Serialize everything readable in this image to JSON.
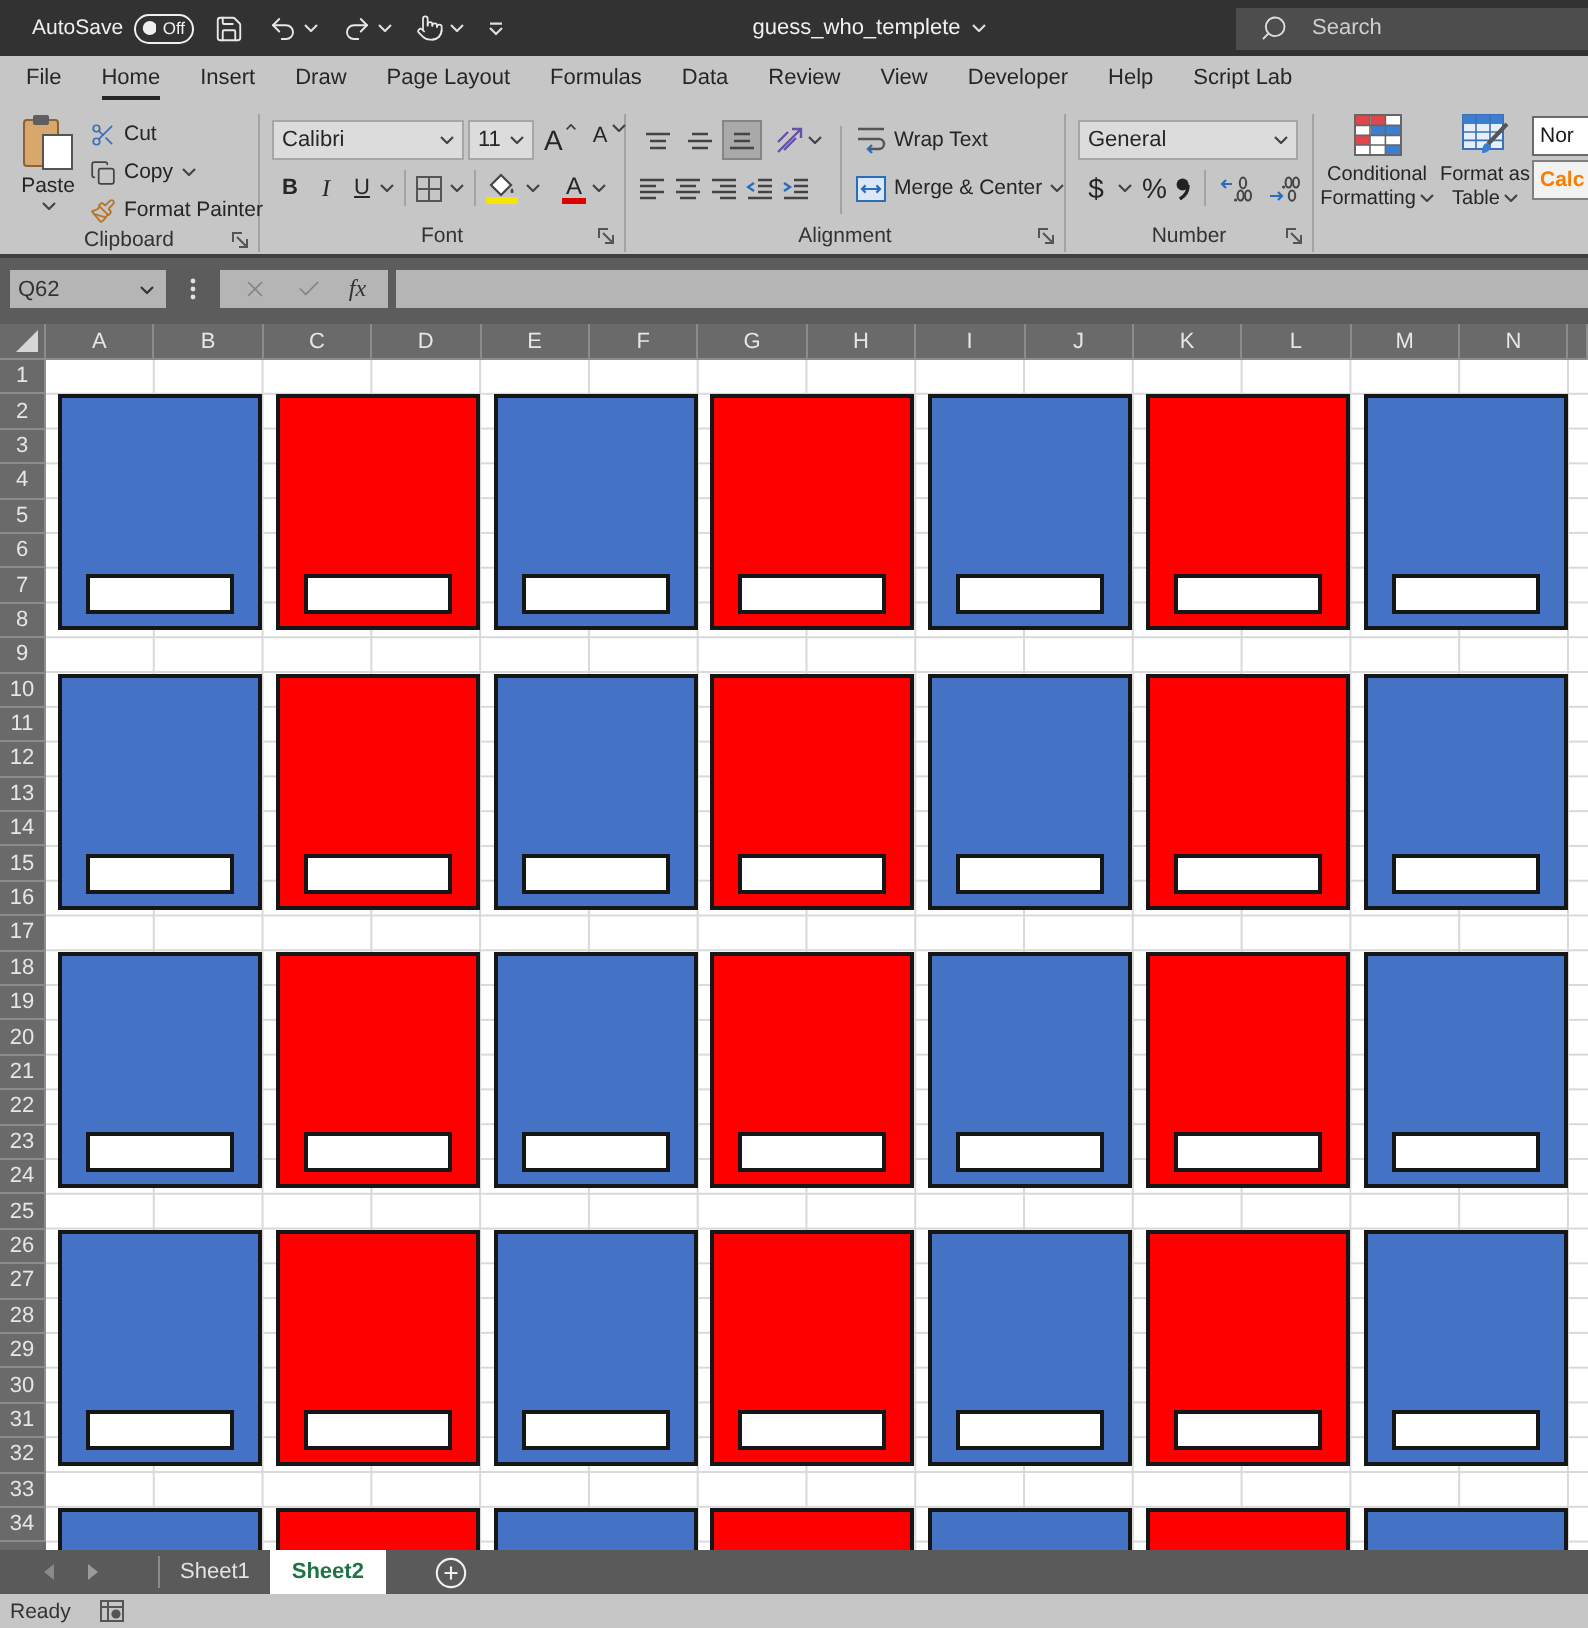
{
  "title_bar": {
    "autosave": {
      "label": "AutoSave",
      "toggle_text": "Off",
      "on": false
    },
    "document_title": "guess_who_templete",
    "search": {
      "placeholder": "Search"
    }
  },
  "ribbon_tabs": [
    {
      "label": "File",
      "selected": false
    },
    {
      "label": "Home",
      "selected": true
    },
    {
      "label": "Insert",
      "selected": false
    },
    {
      "label": "Draw",
      "selected": false
    },
    {
      "label": "Page Layout",
      "selected": false
    },
    {
      "label": "Formulas",
      "selected": false
    },
    {
      "label": "Data",
      "selected": false
    },
    {
      "label": "Review",
      "selected": false
    },
    {
      "label": "View",
      "selected": false
    },
    {
      "label": "Developer",
      "selected": false
    },
    {
      "label": "Help",
      "selected": false
    },
    {
      "label": "Script Lab",
      "selected": false
    }
  ],
  "clipboard": {
    "label": "Clipboard",
    "paste": "Paste",
    "cut": "Cut",
    "copy": "Copy",
    "format_painter": "Format Painter"
  },
  "font": {
    "label": "Font",
    "font_name": "Calibri",
    "font_size": "11",
    "grow": "A",
    "shrink": "A",
    "bold": "B",
    "italic": "I",
    "underline": "U",
    "font_color": "A"
  },
  "alignment": {
    "label": "Alignment",
    "vertical": [
      {
        "kind": "top",
        "selected": false
      },
      {
        "kind": "middle",
        "selected": false
      },
      {
        "kind": "bottom",
        "selected": true
      }
    ],
    "wrap_text": "Wrap Text",
    "merge_center": "Merge & Center"
  },
  "number": {
    "label": "Number",
    "format": "General",
    "currency": "$",
    "percent": "%"
  },
  "styles": {
    "conditional_formatting": "Conditional Formatting",
    "format_as_table": "Format as Table",
    "gallery": [
      {
        "kind": "normal",
        "label": "Nor"
      },
      {
        "kind": "calculation",
        "label": "Calc"
      }
    ]
  },
  "formula_bar": {
    "name_box": "Q62",
    "function": "fx"
  },
  "sheet": {
    "columns": [
      "A",
      "B",
      "C",
      "D",
      "E",
      "F",
      "G",
      "H",
      "I",
      "J",
      "K",
      "L",
      "M",
      "N"
    ],
    "rows": [
      "1",
      "2",
      "3",
      "4",
      "5",
      "6",
      "7",
      "8",
      "9",
      "10",
      "11",
      "12",
      "13",
      "14",
      "15",
      "16",
      "17",
      "18",
      "19",
      "20",
      "21",
      "22",
      "23",
      "24",
      "25",
      "26",
      "27",
      "28",
      "29",
      "30",
      "31",
      "32",
      "33",
      "34"
    ],
    "card_rows": [
      {
        "cards": [
          {
            "color": "#4472c4"
          },
          {
            "color": "#ff0000"
          },
          {
            "color": "#4472c4"
          },
          {
            "color": "#ff0000"
          },
          {
            "color": "#4472c4"
          },
          {
            "color": "#ff0000"
          },
          {
            "color": "#4472c4"
          }
        ]
      },
      {
        "cards": [
          {
            "color": "#4472c4"
          },
          {
            "color": "#ff0000"
          },
          {
            "color": "#4472c4"
          },
          {
            "color": "#ff0000"
          },
          {
            "color": "#4472c4"
          },
          {
            "color": "#ff0000"
          },
          {
            "color": "#4472c4"
          }
        ]
      },
      {
        "cards": [
          {
            "color": "#4472c4"
          },
          {
            "color": "#ff0000"
          },
          {
            "color": "#4472c4"
          },
          {
            "color": "#ff0000"
          },
          {
            "color": "#4472c4"
          },
          {
            "color": "#ff0000"
          },
          {
            "color": "#4472c4"
          }
        ]
      },
      {
        "cards": [
          {
            "color": "#4472c4"
          },
          {
            "color": "#ff0000"
          },
          {
            "color": "#4472c4"
          },
          {
            "color": "#ff0000"
          },
          {
            "color": "#4472c4"
          },
          {
            "color": "#ff0000"
          },
          {
            "color": "#4472c4"
          }
        ]
      },
      {
        "cards": [
          {
            "color": "#4472c4"
          },
          {
            "color": "#ff0000"
          },
          {
            "color": "#4472c4"
          },
          {
            "color": "#ff0000"
          },
          {
            "color": "#4472c4"
          },
          {
            "color": "#ff0000"
          },
          {
            "color": "#4472c4"
          }
        ]
      }
    ]
  },
  "sheet_tabs": [
    {
      "label": "Sheet1",
      "selected": false
    },
    {
      "label": "Sheet2",
      "selected": true
    }
  ],
  "status_bar": {
    "text": "Ready"
  }
}
